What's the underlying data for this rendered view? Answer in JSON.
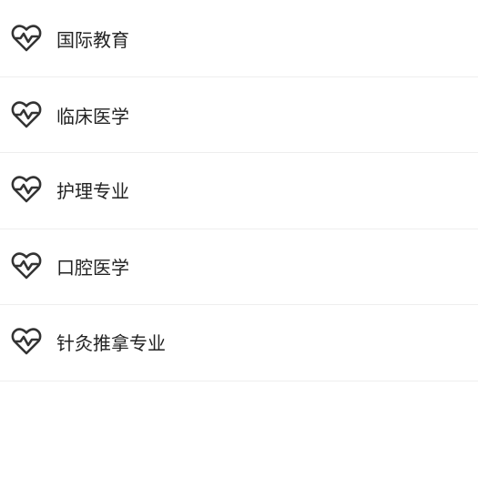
{
  "list": {
    "items": [
      {
        "label": "国际教育",
        "icon": "heart-pulse-icon"
      },
      {
        "label": "临床医学",
        "icon": "heart-pulse-icon"
      },
      {
        "label": "护理专业",
        "icon": "heart-pulse-icon"
      },
      {
        "label": "口腔医学",
        "icon": "heart-pulse-icon"
      },
      {
        "label": "针灸推拿专业",
        "icon": "heart-pulse-icon"
      }
    ]
  },
  "colors": {
    "icon_stroke": "#333333",
    "text": "#222222",
    "divider": "#eeeeee",
    "background": "#ffffff"
  }
}
